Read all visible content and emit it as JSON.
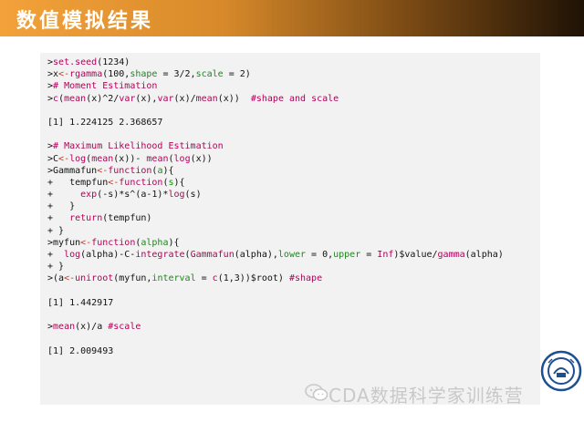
{
  "header": {
    "title": "数值模拟结果"
  },
  "code_lines": [
    {
      "type": "line",
      "segments": [
        {
          "t": ">",
          "c": ""
        },
        {
          "t": "set.seed",
          "c": "f"
        },
        {
          "t": "(1234)",
          "c": ""
        }
      ]
    },
    {
      "type": "line",
      "segments": [
        {
          "t": ">x",
          "c": ""
        },
        {
          "t": "<-",
          "c": "k"
        },
        {
          "t": "rgamma",
          "c": "f"
        },
        {
          "t": "(100,",
          "c": ""
        },
        {
          "t": "shape",
          "c": "g"
        },
        {
          "t": " = 3/2,",
          "c": ""
        },
        {
          "t": "scale",
          "c": "g"
        },
        {
          "t": " = 2)",
          "c": ""
        }
      ]
    },
    {
      "type": "line",
      "segments": [
        {
          "t": ">",
          "c": ""
        },
        {
          "t": "# Moment Estimation",
          "c": "c"
        }
      ]
    },
    {
      "type": "line",
      "segments": [
        {
          "t": ">",
          "c": ""
        },
        {
          "t": "c",
          "c": "f"
        },
        {
          "t": "(",
          "c": ""
        },
        {
          "t": "mean",
          "c": "f"
        },
        {
          "t": "(x)^2/",
          "c": ""
        },
        {
          "t": "var",
          "c": "f"
        },
        {
          "t": "(x),",
          "c": ""
        },
        {
          "t": "var",
          "c": "f"
        },
        {
          "t": "(x)/",
          "c": ""
        },
        {
          "t": "mean",
          "c": "f"
        },
        {
          "t": "(x))  ",
          "c": ""
        },
        {
          "t": "#shape and scale",
          "c": "c"
        }
      ]
    },
    {
      "type": "blank"
    },
    {
      "type": "line",
      "segments": [
        {
          "t": "[1] 1.224125 2.368657",
          "c": ""
        }
      ]
    },
    {
      "type": "blank"
    },
    {
      "type": "line",
      "segments": [
        {
          "t": ">",
          "c": ""
        },
        {
          "t": "# Maximum Likelihood Estimation",
          "c": "c"
        }
      ]
    },
    {
      "type": "line",
      "segments": [
        {
          "t": ">C",
          "c": ""
        },
        {
          "t": "<-",
          "c": "k"
        },
        {
          "t": "log",
          "c": "f"
        },
        {
          "t": "(",
          "c": ""
        },
        {
          "t": "mean",
          "c": "f"
        },
        {
          "t": "(x))- ",
          "c": ""
        },
        {
          "t": "mean",
          "c": "f"
        },
        {
          "t": "(",
          "c": ""
        },
        {
          "t": "log",
          "c": "f"
        },
        {
          "t": "(x))",
          "c": ""
        }
      ]
    },
    {
      "type": "line",
      "segments": [
        {
          "t": ">Gammafun",
          "c": ""
        },
        {
          "t": "<-",
          "c": "k"
        },
        {
          "t": "function",
          "c": "f"
        },
        {
          "t": "(",
          "c": ""
        },
        {
          "t": "a",
          "c": "g"
        },
        {
          "t": "){",
          "c": ""
        }
      ]
    },
    {
      "type": "line",
      "segments": [
        {
          "t": "+   tempfun",
          "c": ""
        },
        {
          "t": "<-",
          "c": "k"
        },
        {
          "t": "function",
          "c": "f"
        },
        {
          "t": "(",
          "c": ""
        },
        {
          "t": "s",
          "c": "g"
        },
        {
          "t": "){",
          "c": ""
        }
      ]
    },
    {
      "type": "line",
      "segments": [
        {
          "t": "+     ",
          "c": ""
        },
        {
          "t": "exp",
          "c": "f"
        },
        {
          "t": "(-s)*s^(a-1)*",
          "c": ""
        },
        {
          "t": "log",
          "c": "f"
        },
        {
          "t": "(s)",
          "c": ""
        }
      ]
    },
    {
      "type": "line",
      "segments": [
        {
          "t": "+   }",
          "c": ""
        }
      ]
    },
    {
      "type": "line",
      "segments": [
        {
          "t": "+   ",
          "c": ""
        },
        {
          "t": "return",
          "c": "f"
        },
        {
          "t": "(tempfun)",
          "c": ""
        }
      ]
    },
    {
      "type": "line",
      "segments": [
        {
          "t": "+ }",
          "c": ""
        }
      ]
    },
    {
      "type": "line",
      "segments": [
        {
          "t": ">myfun",
          "c": ""
        },
        {
          "t": "<-",
          "c": "k"
        },
        {
          "t": "function",
          "c": "f"
        },
        {
          "t": "(",
          "c": ""
        },
        {
          "t": "alpha",
          "c": "g"
        },
        {
          "t": "){",
          "c": ""
        }
      ]
    },
    {
      "type": "line",
      "segments": [
        {
          "t": "+  ",
          "c": ""
        },
        {
          "t": "log",
          "c": "f"
        },
        {
          "t": "(alpha)-C-",
          "c": ""
        },
        {
          "t": "integrate",
          "c": "f"
        },
        {
          "t": "(",
          "c": ""
        },
        {
          "t": "Gammafun",
          "c": "f"
        },
        {
          "t": "(alpha),",
          "c": ""
        },
        {
          "t": "lower",
          "c": "g"
        },
        {
          "t": " = 0,",
          "c": ""
        },
        {
          "t": "upper",
          "c": "g"
        },
        {
          "t": " = ",
          "c": ""
        },
        {
          "t": "Inf",
          "c": "f"
        },
        {
          "t": ")$value/",
          "c": ""
        },
        {
          "t": "gamma",
          "c": "f"
        },
        {
          "t": "(alpha)",
          "c": ""
        }
      ]
    },
    {
      "type": "line",
      "segments": [
        {
          "t": "+ }",
          "c": ""
        }
      ]
    },
    {
      "type": "line",
      "segments": [
        {
          "t": ">(a",
          "c": ""
        },
        {
          "t": "<-",
          "c": "k"
        },
        {
          "t": "uniroot",
          "c": "f"
        },
        {
          "t": "(myfun,",
          "c": ""
        },
        {
          "t": "interval",
          "c": "g"
        },
        {
          "t": " = ",
          "c": ""
        },
        {
          "t": "c",
          "c": "f"
        },
        {
          "t": "(1,3))$root) ",
          "c": ""
        },
        {
          "t": "#shape",
          "c": "c"
        }
      ]
    },
    {
      "type": "blank"
    },
    {
      "type": "line",
      "segments": [
        {
          "t": "[1] 1.442917",
          "c": ""
        }
      ]
    },
    {
      "type": "blank"
    },
    {
      "type": "line",
      "segments": [
        {
          "t": ">",
          "c": ""
        },
        {
          "t": "mean",
          "c": "f"
        },
        {
          "t": "(x)/a ",
          "c": ""
        },
        {
          "t": "#scale",
          "c": "c"
        }
      ]
    },
    {
      "type": "blank"
    },
    {
      "type": "line",
      "segments": [
        {
          "t": "[1] 2.009493",
          "c": ""
        }
      ]
    }
  ],
  "watermark": {
    "text": "CDA数据科学家训练营",
    "icon": "wechat-icon"
  },
  "logo": {
    "icon": "university-seal-icon"
  },
  "colors": {
    "title_gradient_start": "#f3a23a",
    "title_gradient_end": "#1f1206",
    "code_background": "#f2f2f2",
    "assign_arrow": "#c0392b",
    "function_name": "#b5005a",
    "argument_name": "#1a8a1a",
    "comment": "#b5005a"
  }
}
